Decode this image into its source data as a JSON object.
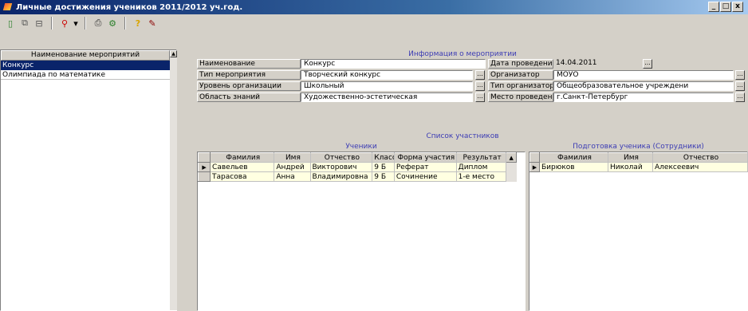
{
  "window": {
    "title": "Личные достижения учеников 2011/2012 уч.год.",
    "buttons": {
      "minimize": "_",
      "maximize": "□",
      "close": "x"
    }
  },
  "toolbar": {
    "icons": [
      "new-document-icon",
      "copy-icon",
      "print-preview-icon",
      "find-icon",
      "dropdown-icon",
      "print-icon",
      "settings-icon",
      "help-icon",
      "wizard-icon"
    ],
    "glyphs": {
      "new": "▯",
      "copy": "⧉",
      "preview": "⊟",
      "find": "⚲",
      "drop": "▾",
      "print": "⎙",
      "settings": "⚙",
      "help": "?",
      "wizard": "✎"
    }
  },
  "events_list": {
    "header": "Наименование мероприятий",
    "items": [
      "Конкурс",
      "Олимпиада по математике"
    ],
    "selected_index": 0
  },
  "event_info": {
    "section_title": "Информация о мероприятии",
    "name_label": "Наименование",
    "name_value": "Конкурс",
    "type_label": "Тип мероприятия",
    "type_value": "Творческий конкурс",
    "level_label": "Уровень организации",
    "level_value": "Школьный",
    "area_label": "Область знаний",
    "area_value": "Художественно-эстетическая",
    "date_label": "Дата проведения",
    "date_value": "14.04.2011",
    "organizer_label": "Организатор",
    "organizer_value": "МОУО",
    "org_type_label": "Тип организатора",
    "org_type_value": "Общеобразовательное учреждени",
    "place_label": "Место проведения",
    "place_value": "г.Санкт-Петербург",
    "dots": "..."
  },
  "participants": {
    "section_title": "Список участников",
    "students": {
      "title": "Ученики",
      "columns": [
        "Фамилия",
        "Имя",
        "Отчество",
        "Класс",
        "Форма участия",
        "Результат"
      ],
      "rows": [
        [
          "Савельев",
          "Андрей",
          "Викторович",
          "9 Б",
          "Реферат",
          "Диплом"
        ],
        [
          "Тарасова",
          "Анна",
          "Владимировна",
          "9 Б",
          "Сочинение",
          "1-е место"
        ]
      ]
    },
    "teachers": {
      "title": "Подготовка ученика (Сотрудники)",
      "columns": [
        "Фамилия",
        "Имя",
        "Отчество"
      ],
      "rows": [
        [
          "Бирюков",
          "Николай",
          "Алексеевич"
        ]
      ]
    }
  }
}
